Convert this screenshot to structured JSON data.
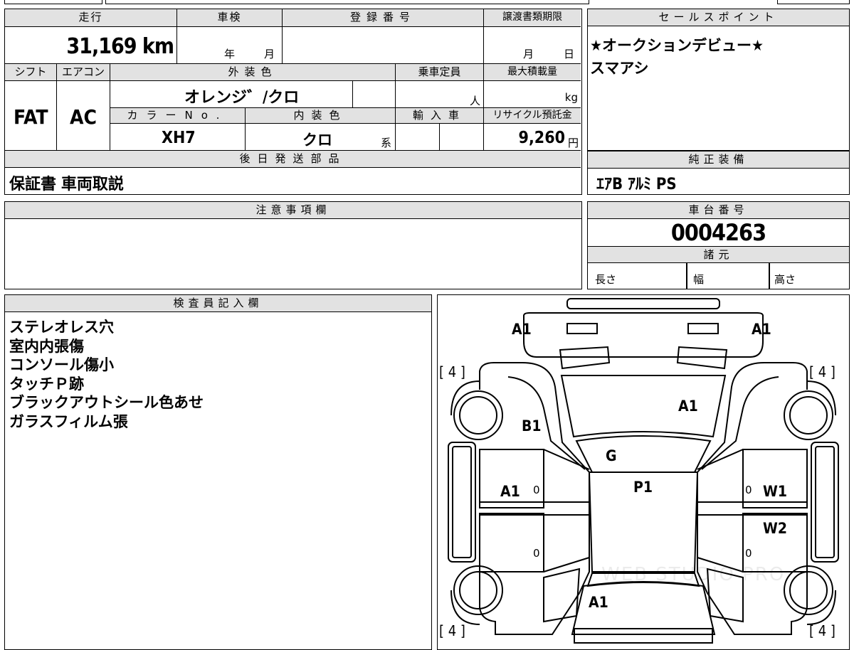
{
  "left_table": {
    "mileage_label": "走行",
    "shaken_label": "車検",
    "registration_label": "登録番号",
    "transfer_deadline_label": "譲渡書類期限",
    "mileage_value": "31,169 km",
    "year_unit": "年",
    "month_unit": "月",
    "deadline_month_unit": "月",
    "deadline_day_unit": "日",
    "shift_label": "シフト",
    "aircon_label": "エアコン",
    "exterior_color_label": "外装色",
    "capacity_label": "乗車定員",
    "max_load_label": "最大積載量",
    "shift_value": "FAT",
    "aircon_value": "AC",
    "exterior_color_value": "オレンジ゛/クロ",
    "capacity_unit": "人",
    "load_unit": "kg",
    "color_no_label": "カラーNo.",
    "interior_color_label": "内装色",
    "import_label": "輸入車",
    "recycle_label": "リサイクル預託金",
    "color_no_value": "XH7",
    "interior_color_value": "クロ",
    "interior_suffix": "系",
    "recycle_value": "9,260",
    "recycle_unit": "円",
    "later_parts_label": "後日発送部品",
    "later_parts_value": "保証書 車両取説"
  },
  "sales_points": {
    "label": "セールスポイント",
    "lines": [
      "★オークションデビュー★",
      "スマアシ"
    ]
  },
  "standard_equipment": {
    "label": "純正装備",
    "value": "ｴｱB ｱﾙﾐ PS"
  },
  "notes": {
    "label": "注意事項欄"
  },
  "chassis": {
    "label": "車台番号",
    "value": "0004263",
    "specs_label": "諸元",
    "length_label": "長さ",
    "width_label": "幅",
    "height_label": "高さ"
  },
  "inspector": {
    "label": "検査員記入欄",
    "lines": [
      "ステレオレス穴",
      "室内内張傷",
      "コンソール傷小",
      "タッチＰ跡",
      "ブラックアウトシール色あせ",
      "ガラスフィルム張"
    ]
  },
  "diagram": {
    "marks": {
      "front_left": "A1",
      "front_right": "A1",
      "hood": "A1",
      "left_front_fender": "B1",
      "windshield": "G",
      "roof": "P1",
      "left_front_door": "A1",
      "right_front_door": "W1",
      "right_rear_door": "W2",
      "rear": "A1"
    },
    "tire_tl": "[ 4 ]",
    "tire_tr": "[ 4 ]",
    "tire_bl": "[ 4 ]",
    "tire_br": "[ 4 ]",
    "door_zero": "0",
    "watermark": "WEB STUDIO PRO"
  }
}
